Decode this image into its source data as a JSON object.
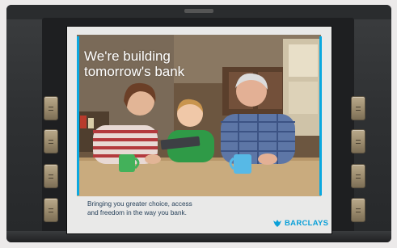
{
  "atm": {
    "screen": {
      "headline_line1": "We're building",
      "headline_line2": "tomorrow's bank",
      "tagline_line1": "Bringing you greater choice, access",
      "tagline_line2": "and freedom in the way you bank.",
      "brand_name": "BARCLAYS",
      "accent_color": "#0aa8e0",
      "brand_color": "#0aa0d8",
      "photo": "family-with-tablet-photo"
    },
    "keys": {
      "left": [
        "left-key-1",
        "left-key-2",
        "left-key-3",
        "left-key-4"
      ],
      "right": [
        "right-key-1",
        "right-key-2",
        "right-key-3",
        "right-key-4"
      ]
    }
  }
}
